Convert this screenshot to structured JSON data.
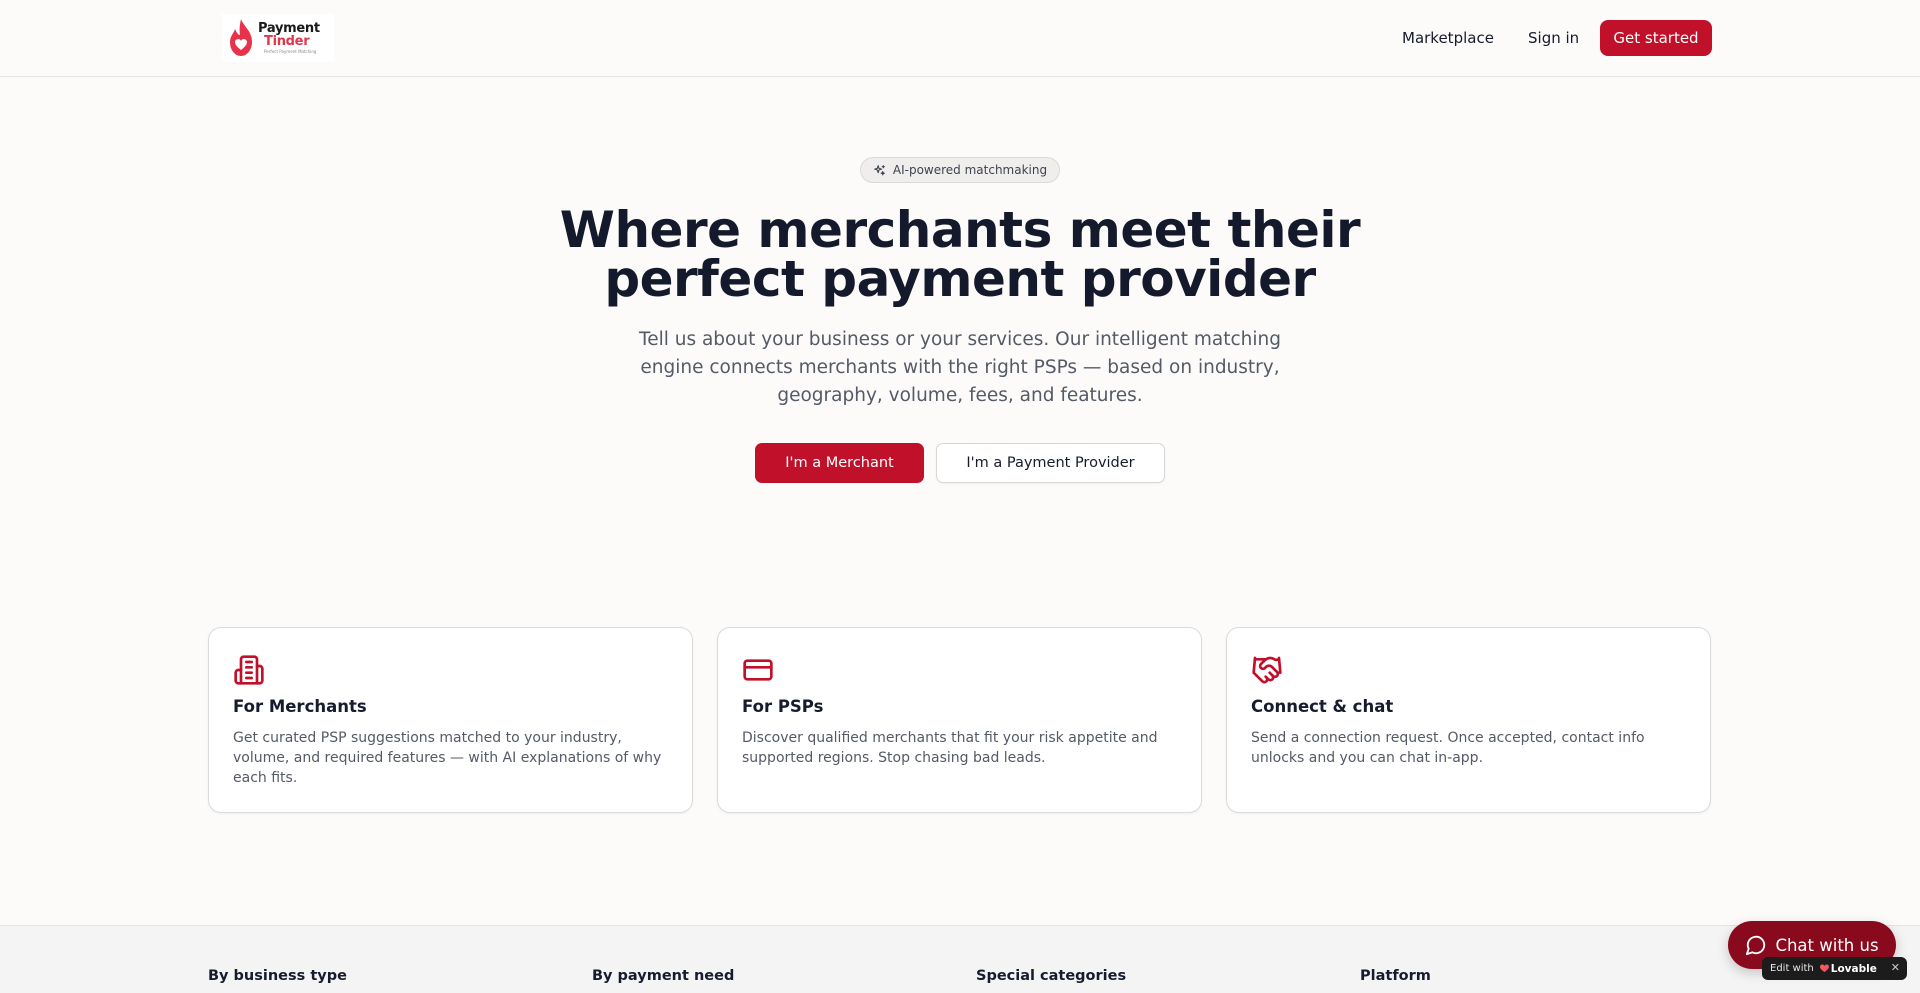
{
  "header": {
    "logo": {
      "line1": "Payment",
      "line2": "Tinder",
      "tagline": "Perfect Payment Matching"
    },
    "nav": {
      "marketplace": "Marketplace",
      "signin": "Sign in",
      "get_started": "Get started"
    }
  },
  "hero": {
    "badge": "AI-powered matchmaking",
    "title_line1": "Where merchants meet their",
    "title_line2": "perfect payment provider",
    "subtitle": "Tell us about your business or your services. Our intelligent matching engine connects merchants with the right PSPs — based on industry, geography, volume, fees, and features.",
    "cta_merchant": "I'm a Merchant",
    "cta_provider": "I'm a Payment Provider"
  },
  "features": [
    {
      "icon": "building-icon",
      "title": "For Merchants",
      "text": "Get curated PSP suggestions matched to your industry, volume, and required features — with AI explanations of why each fits."
    },
    {
      "icon": "credit-card-icon",
      "title": "For PSPs",
      "text": "Discover qualified merchants that fit your risk appetite and supported regions. Stop chasing bad leads."
    },
    {
      "icon": "handshake-icon",
      "title": "Connect & chat",
      "text": "Send a connection request. Once accepted, contact info unlocks and you can chat in-app."
    }
  ],
  "footer": {
    "columns": [
      "By business type",
      "By payment need",
      "Special categories",
      "Platform"
    ]
  },
  "chat": {
    "label": "Chat with us"
  },
  "lovable": {
    "edit_with": "Edit with",
    "brand": "Lovable",
    "close": "✕"
  },
  "colors": {
    "accent": "#c0102a",
    "chat_bg": "#8a0a1d",
    "page_bg": "#fcfbfa"
  }
}
